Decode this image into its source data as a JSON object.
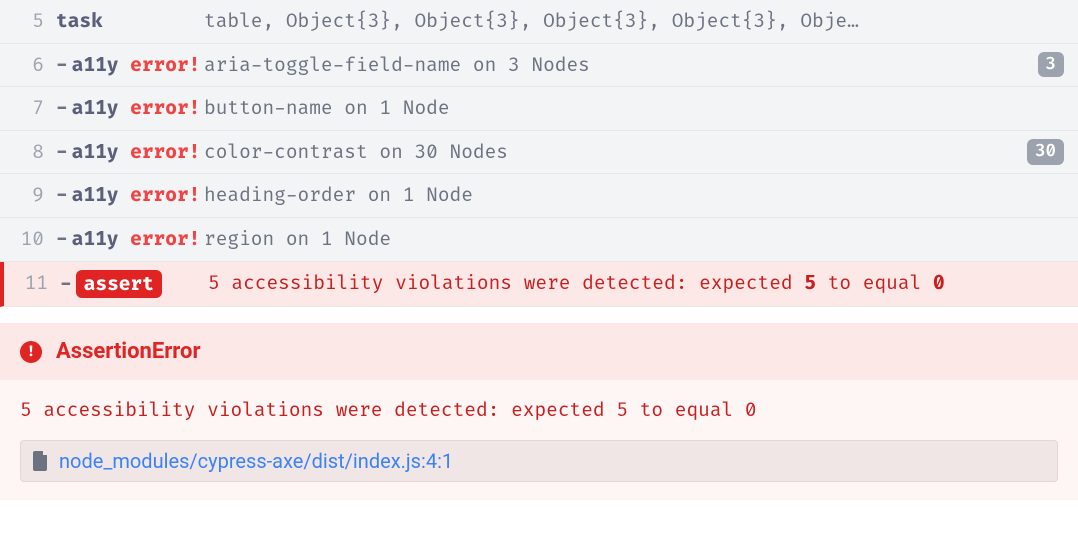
{
  "log": [
    {
      "n": 5,
      "type": "task",
      "msg": "table, Object{3}, Object{3}, Object{3}, Object{3}, Obje…",
      "badge": null
    },
    {
      "n": 6,
      "type": "a11y",
      "msg": "aria-toggle-field-name on 3 Nodes",
      "badge": "3"
    },
    {
      "n": 7,
      "type": "a11y",
      "msg": "button-name on 1 Node",
      "badge": null
    },
    {
      "n": 8,
      "type": "a11y",
      "msg": "color-contrast on 30 Nodes",
      "badge": "30"
    },
    {
      "n": 9,
      "type": "a11y",
      "msg": "heading-order on 1 Node",
      "badge": null
    },
    {
      "n": 10,
      "type": "a11y",
      "msg": "region on 1 Node",
      "badge": null
    }
  ],
  "labels": {
    "task": "task",
    "a11y_a": "a11y",
    "a11y_b": " error!",
    "assert": "assert",
    "dash": "-"
  },
  "assert_line": {
    "n": 11,
    "parts": {
      "p1": "5 accessibility violations were detected: expected ",
      "p2": "5",
      "p3": " to equal ",
      "p4": "0"
    }
  },
  "error": {
    "title": "AssertionError",
    "message": "5 accessibility violations were detected: expected 5 to equal 0",
    "stack_file": "node_modules/cypress-axe/dist/index.js:4:1"
  }
}
